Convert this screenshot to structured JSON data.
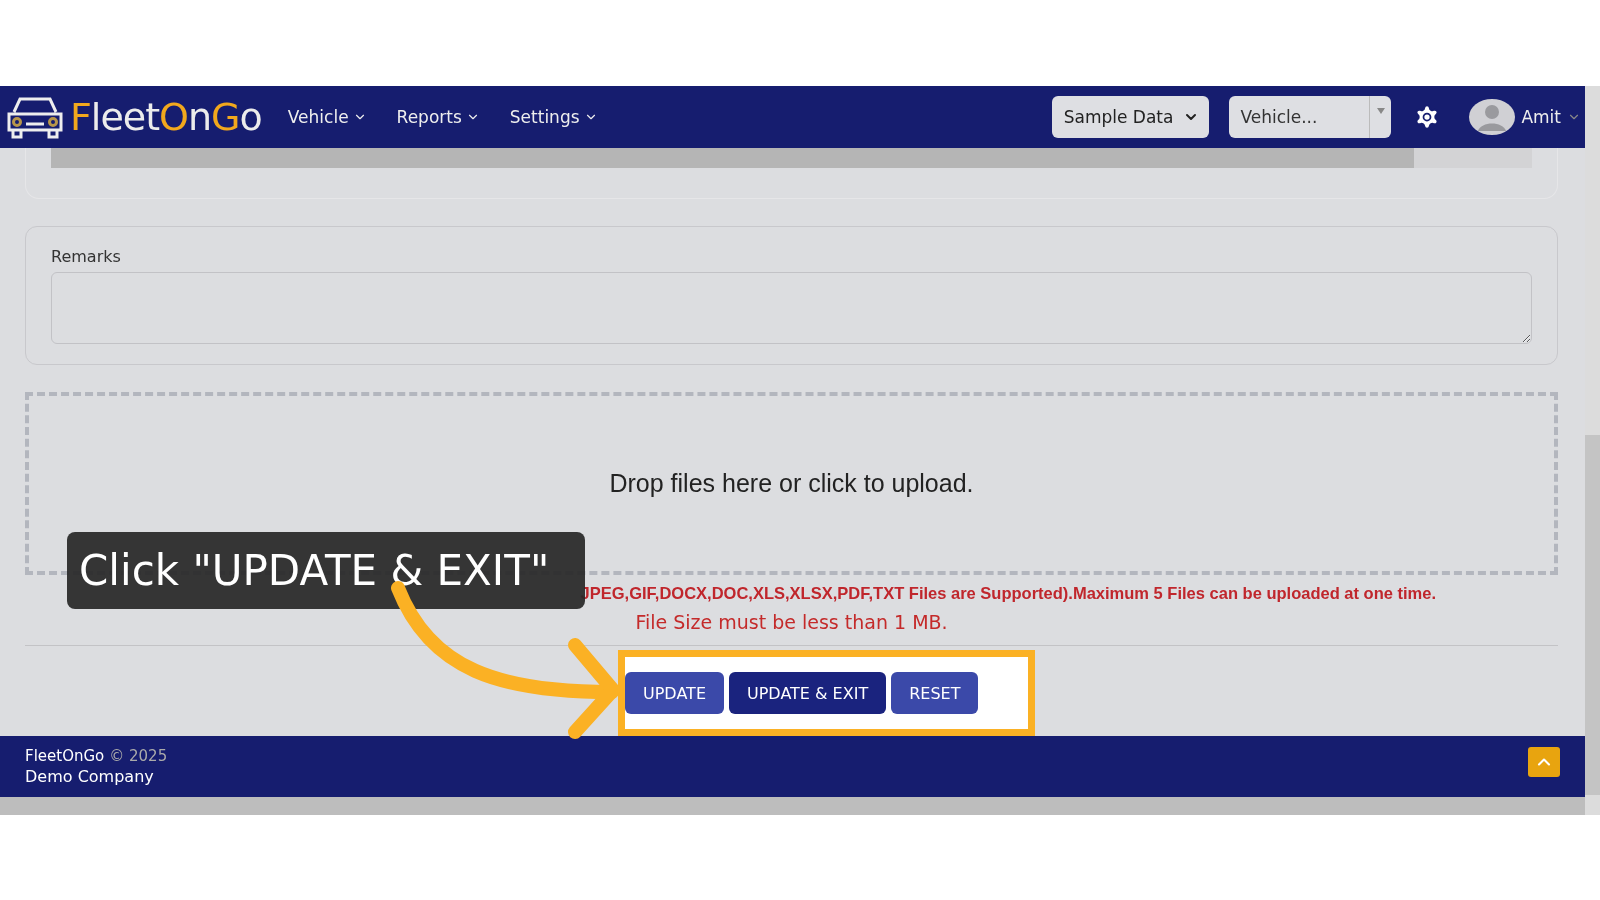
{
  "header": {
    "logo_parts": [
      {
        "text": "F",
        "accent": true
      },
      {
        "text": "leet",
        "accent": false
      },
      {
        "text": "O",
        "accent": true
      },
      {
        "text": "n",
        "accent": false
      },
      {
        "text": "G",
        "accent": true
      },
      {
        "text": "o",
        "accent": false
      }
    ],
    "nav": [
      "Vehicle",
      "Reports",
      "Settings"
    ],
    "data_select": "Sample Data",
    "vehicle_select": {
      "placeholder": "Vehicle..."
    },
    "user": "Amit"
  },
  "progress": {
    "level": 0.92
  },
  "remarks": {
    "label": "Remarks"
  },
  "dropzone": {
    "text": "Drop files here or click to upload."
  },
  "notes": {
    "supported": "JPEG,GIF,DOCX,DOC,XLS,XLSX,PDF,TXT Files are Supported).Maximum 5 Files can be uploaded at one time.",
    "size": "File Size must be less than 1 MB."
  },
  "buttons": [
    {
      "label": "UPDATE",
      "kind": "light"
    },
    {
      "label": "UPDATE & EXIT",
      "kind": "dark"
    },
    {
      "label": "RESET",
      "kind": "light"
    }
  ],
  "footer": {
    "brand": "FleetOnGo",
    "copyright": "© 2025",
    "company": "Demo Company"
  },
  "callout": {
    "text": "Click \"UPDATE & EXIT\""
  }
}
